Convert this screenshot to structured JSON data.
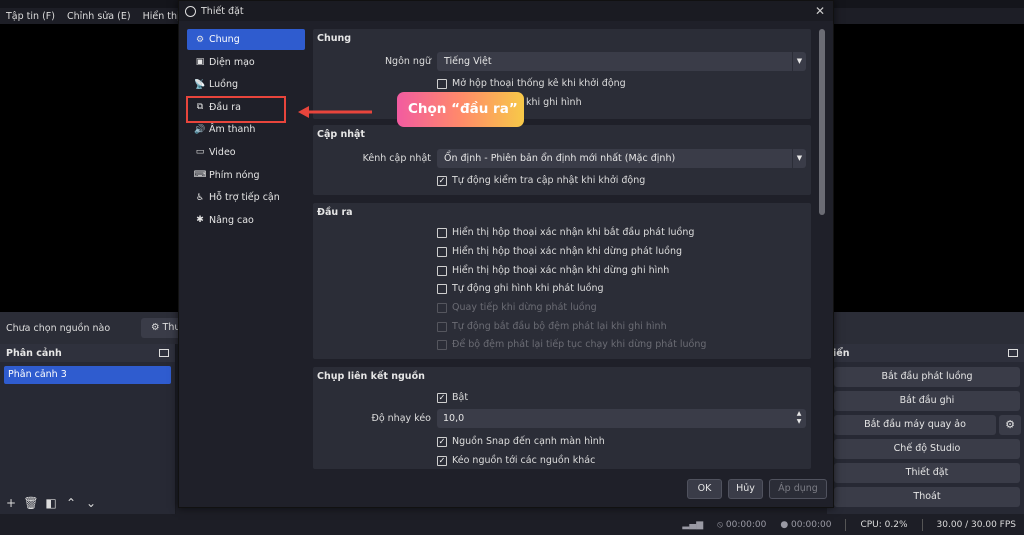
{
  "app": {
    "menu": [
      "Tập tin (F)",
      "Chỉnh sửa (E)",
      "Hiển thị (V)"
    ],
    "source_bar": {
      "label": "Chưa chọn nguồn nào",
      "properties_button": "Thu"
    },
    "scenes": {
      "title": "Phân cảnh",
      "items": [
        "Phân cảnh 3"
      ]
    },
    "controls": {
      "title": "iển",
      "buttons": [
        "Bắt đầu phát luồng",
        "Bắt đầu ghi",
        "Bắt đầu máy quay ảo",
        "Chế độ Studio",
        "Thiết đặt",
        "Thoát"
      ]
    },
    "status": {
      "rec_time": "00:00:00",
      "stream_time": "00:00:00",
      "cpu": "CPU: 0.2%",
      "fps": "30.00 / 30.00 FPS"
    }
  },
  "dialog": {
    "title": "Thiết đặt",
    "sidebar": [
      {
        "label": "Chung",
        "icon": "gear-icon",
        "active": true
      },
      {
        "label": "Diện mạo",
        "icon": "appearance-icon",
        "active": false
      },
      {
        "label": "Luồng",
        "icon": "stream-icon",
        "active": false
      },
      {
        "label": "Đầu ra",
        "icon": "output-icon",
        "active": false
      },
      {
        "label": "Âm thanh",
        "icon": "audio-icon",
        "active": false
      },
      {
        "label": "Video",
        "icon": "video-icon",
        "active": false
      },
      {
        "label": "Phím nóng",
        "icon": "keyboard-icon",
        "active": false
      },
      {
        "label": "Hỗ trợ tiếp cận",
        "icon": "accessibility-icon",
        "active": false
      },
      {
        "label": "Nâng cao",
        "icon": "tools-icon",
        "active": false
      }
    ],
    "general": {
      "title": "Chung",
      "language_label": "Ngôn ngữ",
      "language_value": "Tiếng Việt",
      "check_stats": "Mở hộp thoại thống kê khi khởi động",
      "check_hidden": "khi ghi hình"
    },
    "updates": {
      "title": "Cập nhật",
      "channel_label": "Kênh cập nhật",
      "channel_value": "Ổn định - Phiên bản ổn định mới nhất (Mặc định)",
      "auto_check": "Tự động kiểm tra cập nhật khi khởi động"
    },
    "output": {
      "title": "Đầu ra",
      "options": [
        {
          "label": "Hiển thị hộp thoại xác nhận khi bắt đầu phát luồng",
          "checked": false,
          "disabled": false
        },
        {
          "label": "Hiển thị hộp thoại xác nhận khi dừng phát luồng",
          "checked": false,
          "disabled": false
        },
        {
          "label": "Hiển thị hộp thoại xác nhận khi dừng ghi hình",
          "checked": false,
          "disabled": false
        },
        {
          "label": "Tự động ghi hình khi phát luồng",
          "checked": false,
          "disabled": false
        },
        {
          "label": "Quay tiếp khi dừng phát luồng",
          "checked": false,
          "disabled": true
        },
        {
          "label": "Tự động bắt đầu bộ đệm phát lại khi ghi hình",
          "checked": false,
          "disabled": true
        },
        {
          "label": "Để bộ đệm phát lại tiếp tục chạy khi dừng phát luồng",
          "checked": false,
          "disabled": true
        }
      ]
    },
    "snapping": {
      "title": "Chụp liên kết nguồn",
      "enable": "Bật",
      "sensitivity_label": "Độ nhạy kéo",
      "sensitivity_value": "10,0",
      "snap_screen": "Nguồn Snap đến cạnh màn hình",
      "snap_sources": "Kéo nguồn tới các nguồn khác"
    },
    "buttons": {
      "ok": "OK",
      "cancel": "Hủy",
      "apply": "Áp dụng"
    }
  },
  "annotation": {
    "callout": "Chọn “đầu ra”",
    "color": "#e8453c"
  }
}
